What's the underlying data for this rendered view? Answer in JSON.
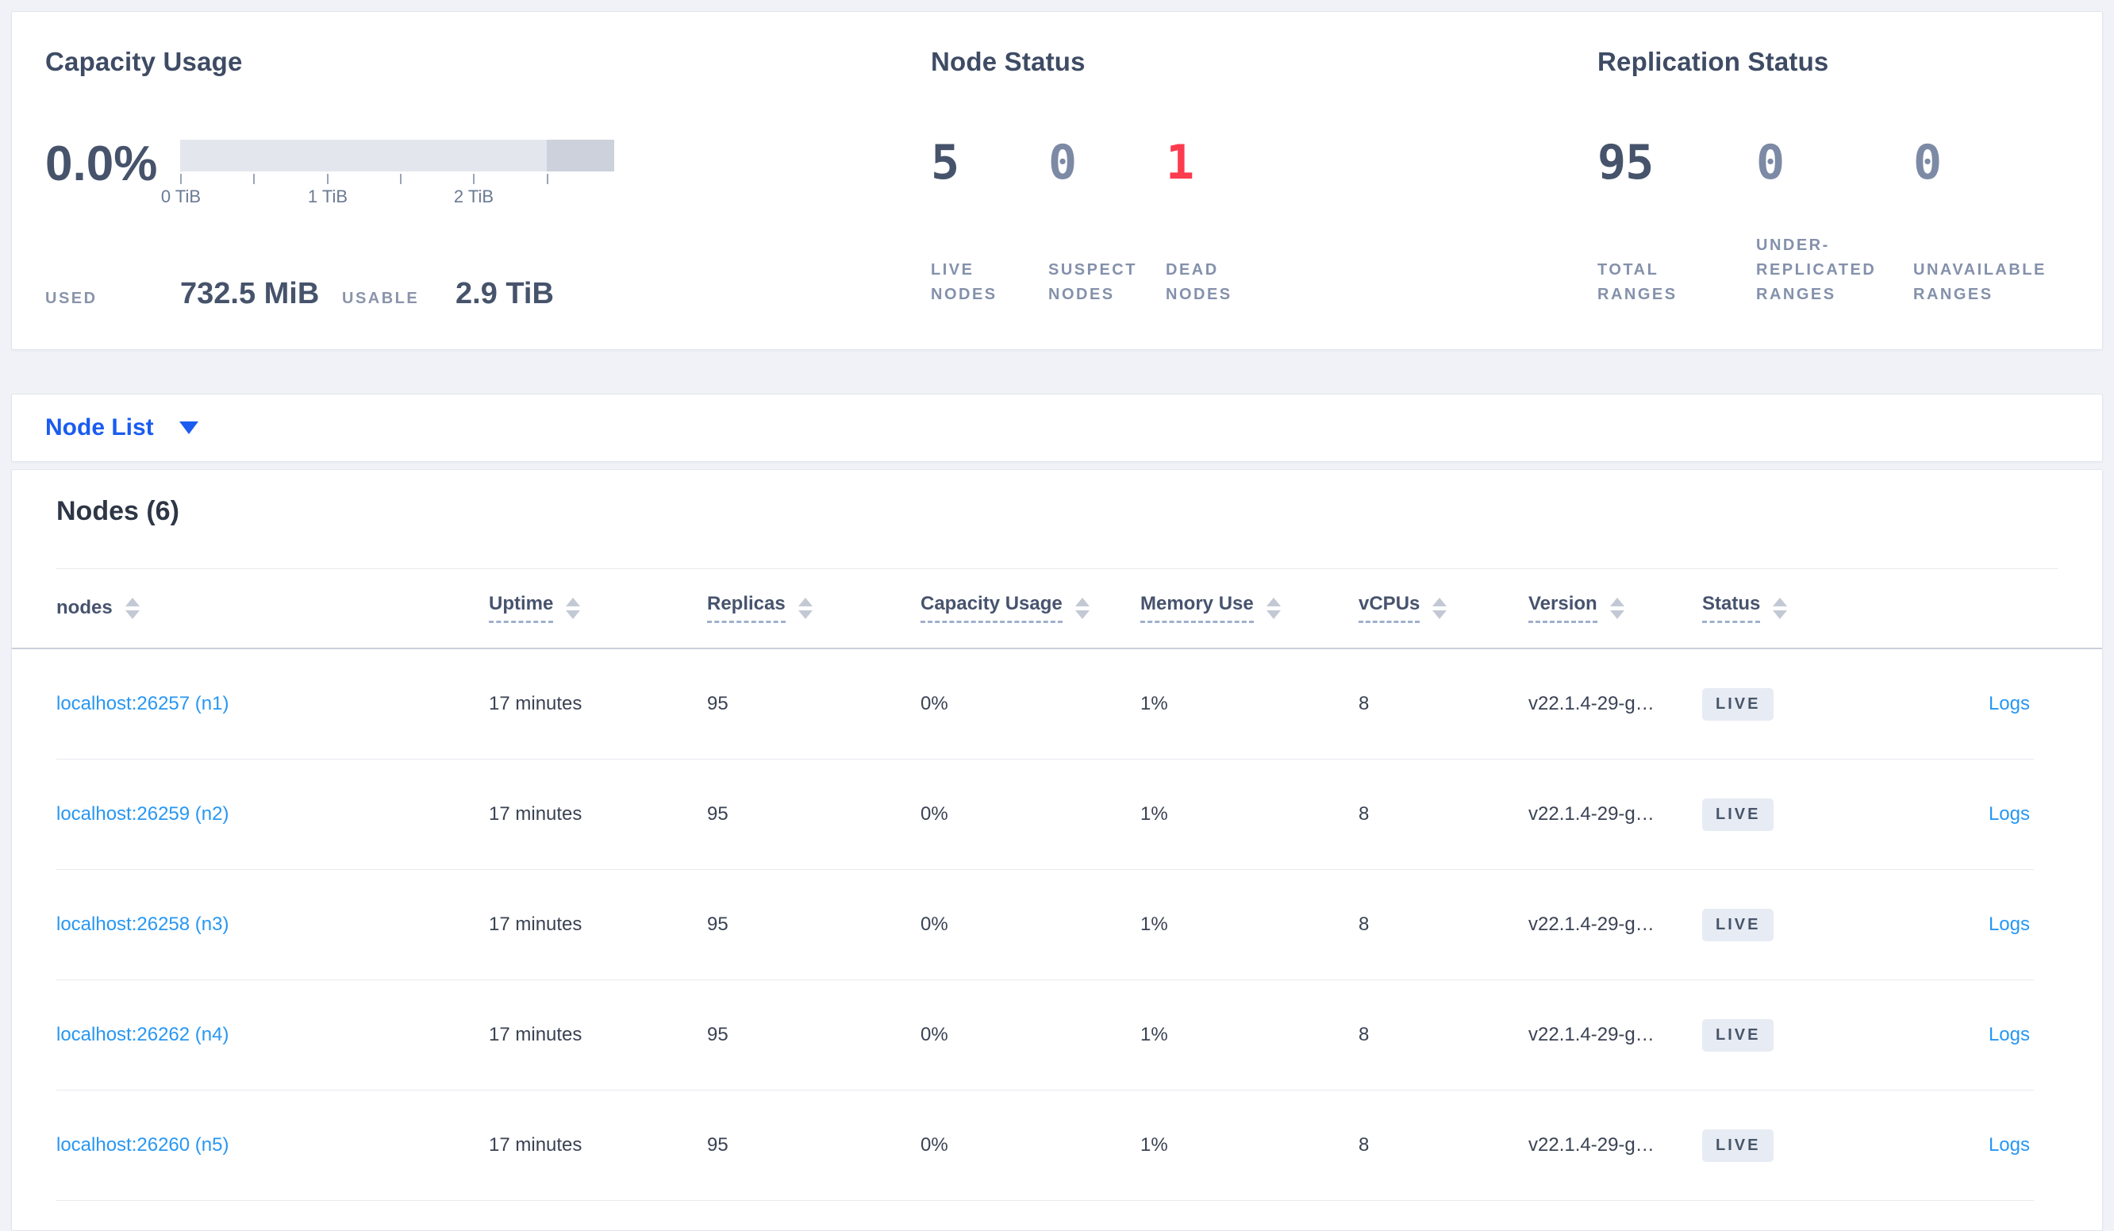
{
  "colors": {
    "page_background": "#f0f2f7",
    "link_blue": "#2897f2",
    "selector_blue": "#1a5cf0",
    "dead_red": "#fc3b4e",
    "stat_dark": "#46536b",
    "stat_muted": "#7d8aa6",
    "badge_background": "#e7ebf3"
  },
  "summary": {
    "capacity": {
      "title": "Capacity Usage",
      "percent": "0.0%",
      "used_label": "USED",
      "used_value": "732.5 MiB",
      "usable_label": "USABLE",
      "usable_value": "2.9 TiB",
      "axis_ticks": [
        "0 TiB",
        "1 TiB",
        "2 TiB"
      ]
    },
    "node_status": {
      "title": "Node Status",
      "stats": [
        {
          "value": "5",
          "label": "LIVE NODES"
        },
        {
          "value": "0",
          "label": "SUSPECT NODES"
        },
        {
          "value": "1",
          "label": "DEAD NODES"
        }
      ]
    },
    "replication_status": {
      "title": "Replication Status",
      "stats": [
        {
          "value": "95",
          "label": "TOTAL RANGES"
        },
        {
          "value": "0",
          "label": "UNDER-REPLICATED RANGES"
        },
        {
          "value": "0",
          "label": "UNAVAILABLE RANGES"
        }
      ]
    }
  },
  "view_selector": {
    "label": "Node List"
  },
  "nodes_table": {
    "title": "Nodes (6)",
    "headers": [
      "nodes",
      "Uptime",
      "Replicas",
      "Capacity Usage",
      "Memory Use",
      "vCPUs",
      "Version",
      "Status"
    ],
    "rows": [
      {
        "address": "localhost:26257 (n1)",
        "uptime": "17 minutes",
        "replicas": "95",
        "capacity": "0%",
        "memory": "1%",
        "vcpus": "8",
        "version": "v22.1.4-29-g…",
        "status": "LIVE",
        "logs": "Logs"
      },
      {
        "address": "localhost:26259 (n2)",
        "uptime": "17 minutes",
        "replicas": "95",
        "capacity": "0%",
        "memory": "1%",
        "vcpus": "8",
        "version": "v22.1.4-29-g…",
        "status": "LIVE",
        "logs": "Logs"
      },
      {
        "address": "localhost:26258 (n3)",
        "uptime": "17 minutes",
        "replicas": "95",
        "capacity": "0%",
        "memory": "1%",
        "vcpus": "8",
        "version": "v22.1.4-29-g…",
        "status": "LIVE",
        "logs": "Logs"
      },
      {
        "address": "localhost:26262 (n4)",
        "uptime": "17 minutes",
        "replicas": "95",
        "capacity": "0%",
        "memory": "1%",
        "vcpus": "8",
        "version": "v22.1.4-29-g…",
        "status": "LIVE",
        "logs": "Logs"
      },
      {
        "address": "localhost:26260 (n5)",
        "uptime": "17 minutes",
        "replicas": "95",
        "capacity": "0%",
        "memory": "1%",
        "vcpus": "8",
        "version": "v22.1.4-29-g…",
        "status": "LIVE",
        "logs": "Logs"
      }
    ]
  }
}
